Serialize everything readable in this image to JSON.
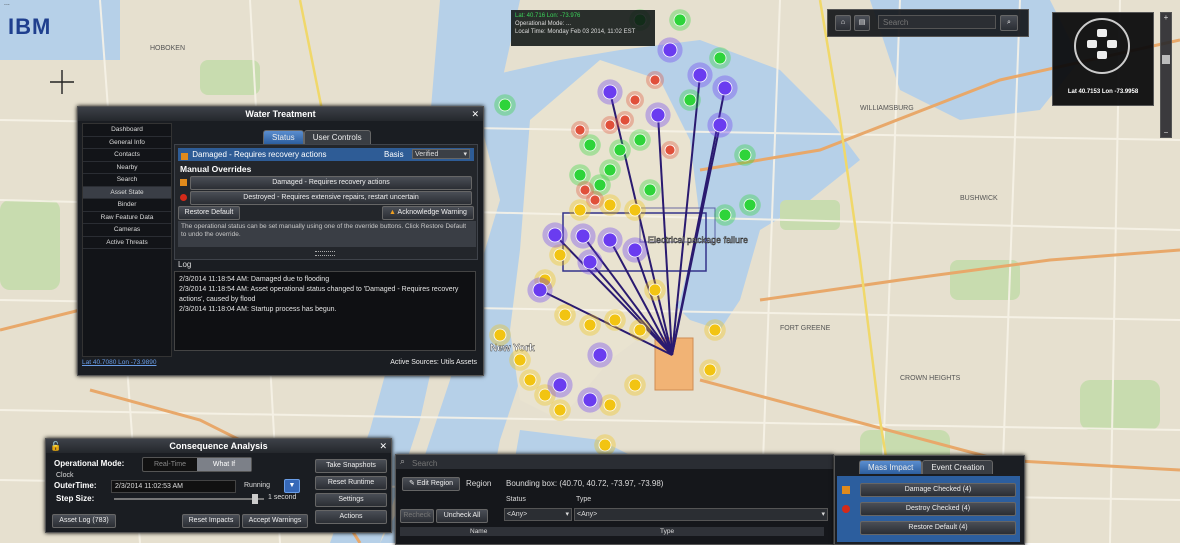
{
  "app": {
    "logo": "IBM",
    "top_left_fragment": "..."
  },
  "info_box": {
    "lines": [
      "Lat: 40.716  Lon: -73.976",
      "Operational Mode: ...",
      "Local Time: Monday Feb 03 2014, 11:02 EST"
    ]
  },
  "search": {
    "placeholder": "Search"
  },
  "compass": {
    "coords": "Lat 40.7153  Lon -73.9958"
  },
  "map_labels": {
    "callout": "Electrical package failure",
    "new_york": "New York"
  },
  "water_panel": {
    "title": "Water Treatment",
    "sidebar": [
      "Dashboard",
      "General Info",
      "Contacts",
      "Nearby",
      "Search",
      "Asset State",
      "Binder",
      "Raw Feature Data",
      "Cameras",
      "Active Threats"
    ],
    "tabs": [
      "Status",
      "User Controls"
    ],
    "status_text": "Damaged - Requires recovery actions",
    "basis_label": "Basis",
    "basis_value": "Verified",
    "manual_overrides_title": "Manual Overrides",
    "override_damaged": "Damaged - Requires recovery actions",
    "override_destroyed": "Destroyed - Requires extensive repairs, restart uncertain",
    "restore_default": "Restore Default",
    "acknowledge_warning": "Acknowledge Warning",
    "note": "The operational status can be set manually using one of the override buttons. Click Restore Default to undo the override.",
    "log_title": "Log",
    "log_lines": [
      "2/3/2014 11:18:54 AM: Damaged due to flooding",
      "2/3/2014 11:18:54 AM: Asset operational status changed to 'Damaged - Requires recovery actions', caused by flood",
      "2/3/2014 11:18:04 AM: Startup process has begun."
    ],
    "footer_coords": "Lat 40.7080  Lon -73.9890",
    "active_sources": "Active Sources: Utils Assets"
  },
  "consequence_panel": {
    "title": "Consequence Analysis",
    "operational_mode_label": "Operational Mode:",
    "mode_options": [
      "Real-Time",
      "What If"
    ],
    "clock_label": "Clock",
    "outer_time_label": "OuterTime:",
    "outer_time_value": "2/3/2014 11:02:53 AM",
    "running_label": "Running",
    "step_size_label": "Step Size:",
    "step_value": "1 second",
    "side_buttons": [
      "Take Snapshots",
      "Reset Runtime",
      "Settings",
      "Actions"
    ],
    "bottom_buttons": [
      "Asset Log (783)",
      "Reset Impacts",
      "Accept Warnings"
    ]
  },
  "bottom_panel": {
    "search_placeholder": "Search",
    "edit_region": "Edit Region",
    "region_label": "Region",
    "bounding_box": "Bounding box: (40.70, 40.72, -73.97, -73.98)",
    "status_label": "Status",
    "type_label": "Type",
    "status_value": "<Any>",
    "type_value": "<Any>",
    "recheck": "Recheck",
    "uncheck_all": "Uncheck All",
    "col_name": "Name",
    "col_type": "Type"
  },
  "impact_panel": {
    "tabs": [
      "Mass Impact",
      "Event Creation"
    ],
    "rows": [
      "Damage Checked (4)",
      "Destroy Checked (4)",
      "Restore Default (4)"
    ],
    "row_colors": [
      "#e08a1c",
      "#d42a1a",
      "#888888"
    ]
  },
  "colors": {
    "accent": "#2c5e9e",
    "purple_marker": "#6a3cf0",
    "yellow_marker": "#f2c412",
    "green_marker": "#2ed43a",
    "red_marker": "#e0503a"
  }
}
